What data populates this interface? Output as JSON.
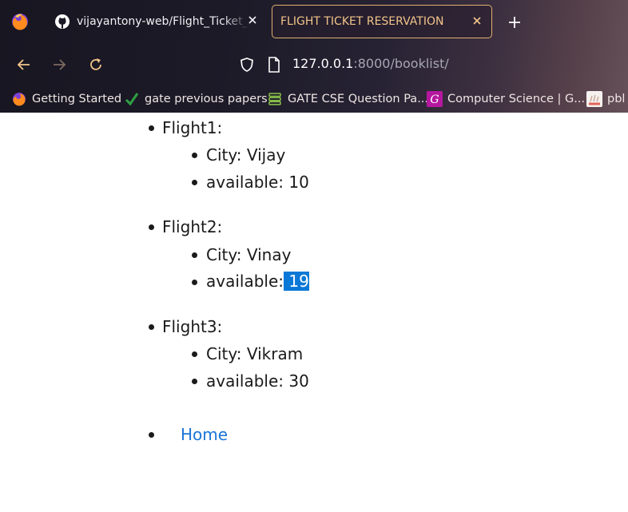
{
  "browser": {
    "tabs": [
      {
        "title": "vijayantony-web/Flight_Ticket_Booking",
        "icon": "github-icon"
      },
      {
        "title": "FLIGHT TICKET RESERVATION",
        "icon": "none"
      }
    ],
    "url": {
      "host": "127.0.0.1",
      "rest": ":8000/booklist/"
    },
    "bookmarks": [
      {
        "label": "Getting Started",
        "icon": "firefox-icon"
      },
      {
        "label": "gate previous papers",
        "icon": "check-icon"
      },
      {
        "label": "GATE CSE Question Pa...",
        "icon": "stack-icon"
      },
      {
        "label": "Computer Science | G...",
        "icon": "g-icon"
      },
      {
        "label": "pbl",
        "icon": "pbl-icon"
      }
    ],
    "colors": {
      "active_tab_border": "#e0b070",
      "active_tab_text": "#f2c58a",
      "selection": "#0a78d7",
      "link": "#1a73d6"
    }
  },
  "page": {
    "flights": [
      {
        "label": "Flight1:",
        "city": "City: Vijay",
        "available_label": "available:",
        "available_value": "10"
      },
      {
        "label": "Flight2:",
        "city": "City: Vinay",
        "available_label": "available:",
        "available_value": "19"
      },
      {
        "label": "Flight3:",
        "city": "City: Vikram",
        "available_label": "available:",
        "available_value": "30"
      }
    ],
    "home_link": "Home"
  }
}
